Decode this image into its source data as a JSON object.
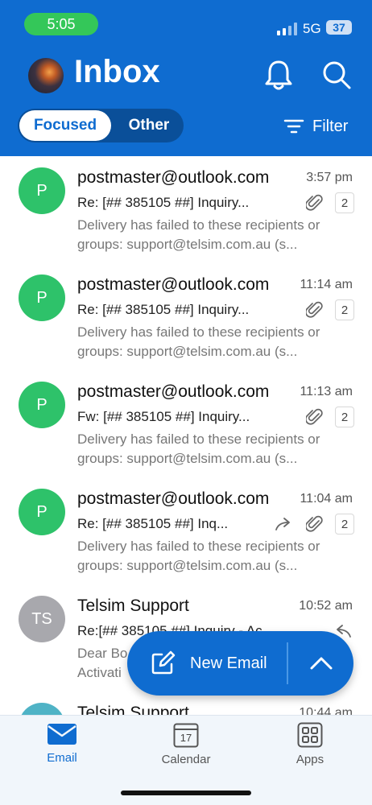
{
  "status": {
    "time": "5:05",
    "network": "5G",
    "battery": "37"
  },
  "header": {
    "title": "Inbox",
    "tabs": {
      "focused": "Focused",
      "other": "Other"
    },
    "filter_label": "Filter"
  },
  "messages": [
    {
      "initials": "P",
      "avatar_color": "#2ec26a",
      "sender": "postmaster@outlook.com",
      "time": "3:57 pm",
      "subject": "Re: [## 385105 ##] Inquiry...",
      "preview": "Delivery has failed to these recipients or groups: support@telsim.com.au (s...",
      "count": "2"
    },
    {
      "initials": "P",
      "avatar_color": "#2ec26a",
      "sender": "postmaster@outlook.com",
      "time": "11:14 am",
      "subject": "Re: [## 385105 ##] Inquiry...",
      "preview": "Delivery has failed to these recipients or groups: support@telsim.com.au (s...",
      "count": "2"
    },
    {
      "initials": "P",
      "avatar_color": "#2ec26a",
      "sender": "postmaster@outlook.com",
      "time": "11:13 am",
      "subject": "Fw: [## 385105 ##] Inquiry...",
      "preview": "Delivery has failed to these recipients or groups: support@telsim.com.au (s...",
      "count": "2"
    },
    {
      "initials": "P",
      "avatar_color": "#2ec26a",
      "sender": "postmaster@outlook.com",
      "time": "11:04 am",
      "subject": "Re: [## 385105 ##] Inq...",
      "preview": "Delivery has failed to these recipients or groups: support@telsim.com.au (s...",
      "count": "2"
    },
    {
      "initials": "TS",
      "avatar_color": "#a8a8ad",
      "sender": "Telsim Support",
      "time": "10:52 am",
      "subject": "Re:[## 385105 ##] Inquiry - Ac",
      "preview": "Dear Bo Activati"
    },
    {
      "initials": "",
      "avatar_color": "#4fb3c6",
      "sender": "Telsim Support",
      "time": "10:44 am"
    }
  ],
  "fab": {
    "label": "New Email"
  },
  "tabbar": {
    "mail": "Email",
    "calendar": "Calendar",
    "calendar_day": "17",
    "apps": "Apps"
  },
  "colors": {
    "brand": "#0f6cd0",
    "green_avatar": "#2ec26a",
    "status_green": "#34c759"
  }
}
